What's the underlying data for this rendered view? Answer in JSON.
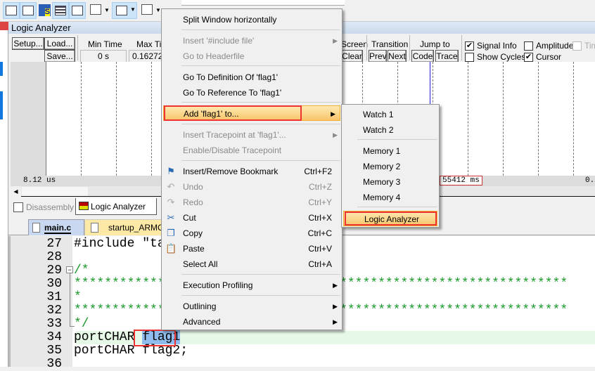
{
  "toolbar": {
    "icons": [
      "command-window-icon",
      "disassembly-icon",
      "symbols-icon",
      "registers-icon",
      "call-stack-icon",
      "watch-icon",
      "memory-icon",
      "serial-icon",
      "analysis-icon",
      "trace-icon",
      "system-viewer-icon"
    ]
  },
  "logic_analyzer": {
    "title": "Logic Analyzer",
    "setup": "Setup...",
    "load": "Load...",
    "save": "Save...",
    "min_time_label": "Min Time",
    "min_time": "0 s",
    "max_time_label": "Max Time",
    "max_time": "0.16272",
    "screen_label": "Screen",
    "clear": "Clear",
    "transition_label": "Transition",
    "prev": "Prev",
    "next": "Next",
    "jump_label": "Jump to",
    "code": "Code",
    "trace": "Trace",
    "signal_info": {
      "label": "Signal Info",
      "checked": true
    },
    "show_cycles": {
      "label": "Show Cycles",
      "checked": false
    },
    "amplitude": {
      "label": "Amplitude",
      "checked": false
    },
    "cursor": {
      "label": "Cursor",
      "checked": true
    },
    "timestamps": {
      "label": "Tim",
      "checked": false
    },
    "time_left": "8.12 us",
    "cursor_time": "55412 ms",
    "time_right": "0."
  },
  "bottom_tabs": [
    {
      "label": "Disassembly",
      "active": false
    },
    {
      "label": "Logic Analyzer",
      "active": true
    }
  ],
  "editor_tabs": [
    {
      "label": "main.c",
      "active": true
    },
    {
      "label": "startup_ARMCM3"
    }
  ],
  "code_lines": [
    {
      "n": "27",
      "text": "#include \"task.h\""
    },
    {
      "n": "28",
      "text": ""
    },
    {
      "n": "29",
      "text": "/*"
    },
    {
      "n": "30",
      "text": "*****************************************************************"
    },
    {
      "n": "31",
      "text": "*"
    },
    {
      "n": "32",
      "text": "*****************************************************************"
    },
    {
      "n": "33",
      "text": "*/"
    },
    {
      "n": "34",
      "text": "portCHAR ",
      "sel": "flag1"
    },
    {
      "n": "35",
      "text": "portCHAR flag2;"
    },
    {
      "n": "36",
      "text": ""
    }
  ],
  "context_menu": {
    "items": [
      {
        "label": "Split Window horizontally"
      },
      {
        "label": "Insert '#include file'",
        "disabled": true,
        "submenu": true
      },
      {
        "label": "Go to Headerfile",
        "disabled": true
      },
      {
        "label": "Go To Definition Of 'flag1'"
      },
      {
        "label": "Go To Reference To 'flag1'"
      },
      {
        "label": "Add 'flag1' to...",
        "submenu": true,
        "highlighted": true
      },
      {
        "label": "Insert Tracepoint at 'flag1'...",
        "disabled": true,
        "submenu": true
      },
      {
        "label": "Enable/Disable Tracepoint",
        "disabled": true
      },
      {
        "label": "Insert/Remove Bookmark",
        "shortcut": "Ctrl+F2",
        "icon": "bookmark-flag-icon"
      },
      {
        "label": "Undo",
        "shortcut": "Ctrl+Z",
        "disabled": true,
        "icon": "undo-icon"
      },
      {
        "label": "Redo",
        "shortcut": "Ctrl+Y",
        "disabled": true,
        "icon": "redo-icon"
      },
      {
        "label": "Cut",
        "shortcut": "Ctrl+X",
        "icon": "scissors-icon"
      },
      {
        "label": "Copy",
        "shortcut": "Ctrl+C",
        "icon": "copy-icon"
      },
      {
        "label": "Paste",
        "shortcut": "Ctrl+V",
        "icon": "paste-icon"
      },
      {
        "label": "Select All",
        "shortcut": "Ctrl+A"
      },
      {
        "label": "Execution Profiling",
        "submenu": true
      },
      {
        "label": "Outlining",
        "submenu": true
      },
      {
        "label": "Advanced",
        "submenu": true
      }
    ]
  },
  "submenu": {
    "items": [
      {
        "label": "Watch 1"
      },
      {
        "label": "Watch 2"
      },
      {
        "label": "Memory 1"
      },
      {
        "label": "Memory 2"
      },
      {
        "label": "Memory 3"
      },
      {
        "label": "Memory 4"
      },
      {
        "label": "Logic Analyzer",
        "highlighted": true
      }
    ]
  },
  "colors": {
    "highlight_box": "#ee3333",
    "menu_highlight": "#f9c56a",
    "selection": "#8fbcec",
    "current_line": "#e6f8e6",
    "comment": "#1a9a2a"
  }
}
